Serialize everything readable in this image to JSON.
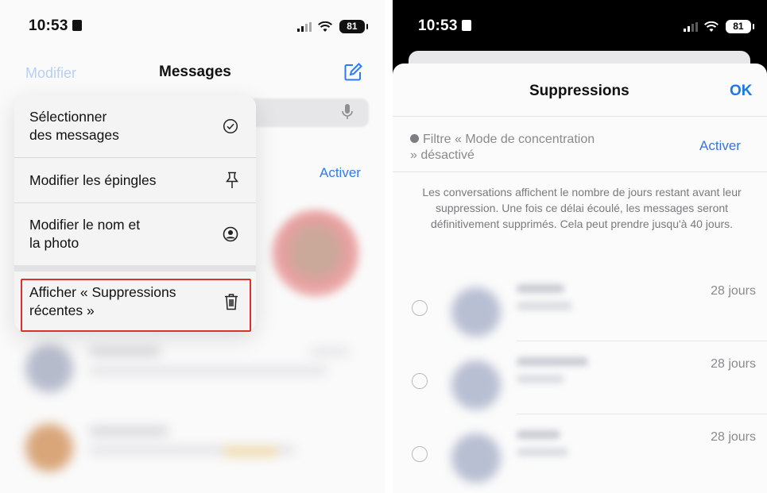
{
  "left": {
    "status": {
      "time": "10:53",
      "battery": "81"
    },
    "nav": {
      "edit_label": "Modifier",
      "title": "Messages"
    },
    "activer_label": "Activer",
    "menu": [
      {
        "label": "Sélectionner\ndes messages",
        "icon": "checkmark-circle-icon"
      },
      {
        "label": "Modifier les épingles",
        "icon": "pin-icon"
      },
      {
        "label": "Modifier le nom et\nla photo",
        "icon": "person-circle-icon"
      },
      {
        "label": "Afficher « Suppressions\nrécentes »",
        "icon": "trash-icon"
      }
    ],
    "highlight_color": "#d8322b"
  },
  "right": {
    "status": {
      "time": "10:53",
      "battery": "81"
    },
    "sheet": {
      "title": "Suppressions",
      "ok_label": "OK",
      "filter_text": "Filtre « Mode de concentration » désactivé",
      "filter_action": "Activer",
      "info": "Les conversations affichent le nombre de jours restant avant leur suppression. Une fois ce délai écoulé, les messages seront définitivement supprimés. Cela peut prendre jusqu'à 40 jours.",
      "conversations": [
        {
          "days": "28 jours"
        },
        {
          "days": "28 jours"
        },
        {
          "days": "28 jours"
        }
      ]
    },
    "accent_color": "#1a78e8"
  }
}
